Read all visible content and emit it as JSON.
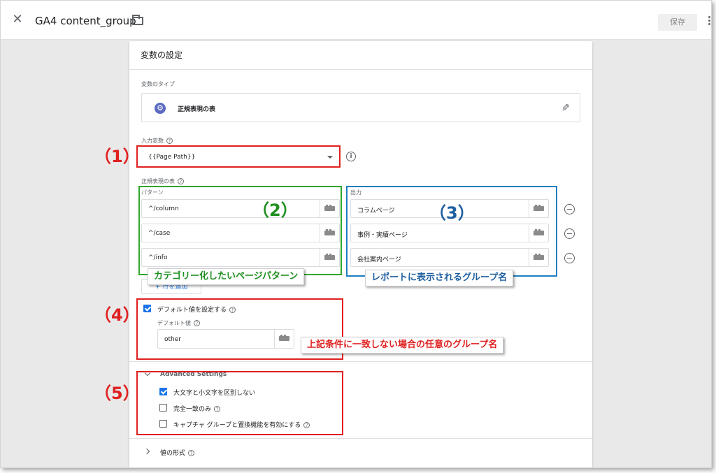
{
  "header": {
    "title": "GA4 content_group",
    "save_label": "保存"
  },
  "config": {
    "section_title": "変数の設定",
    "variable_type_label": "変数のタイプ",
    "variable_type_value": "正規表現の表",
    "input_variable_label": "入力変数",
    "input_variable_value": "{{Page Path}}",
    "regex_table_label": "正規表現の表",
    "pattern_header": "パターン",
    "output_header": "出力",
    "rows": [
      {
        "pattern": "^/column",
        "output": "コラムページ"
      },
      {
        "pattern": "^/case",
        "output": "事例・実績ページ"
      },
      {
        "pattern": "^/info",
        "output": "会社案内ページ"
      }
    ],
    "add_row_label": "+ 行を追加",
    "set_default_label": "デフォルト値を設定する",
    "default_value_label": "デフォルト値",
    "default_value": "other",
    "advanced_settings_label": "Advanced Settings",
    "advanced": [
      {
        "label": "大文字と小文字を区別しない",
        "checked": true
      },
      {
        "label": "完全一致のみ",
        "checked": false
      },
      {
        "label": "キャプチャ グループと置換機能を有効にする",
        "checked": false
      }
    ],
    "format_label": "値の形式"
  },
  "annotations": {
    "n1": "（1）",
    "n2": "（2）",
    "n3": "（3）",
    "n4": "（4）",
    "n5": "（5）",
    "pattern_callout": "カテゴリー化したいページパターン",
    "output_callout": "レポートに表示されるグループ名",
    "default_callout": "上記条件に一致しない場合の任意のグループ名"
  },
  "colors": {
    "annotation_red": "#e02020",
    "annotation_green": "#2ea82e",
    "annotation_blue": "#1f7fc0",
    "checkbox_blue": "#1a73e8"
  }
}
